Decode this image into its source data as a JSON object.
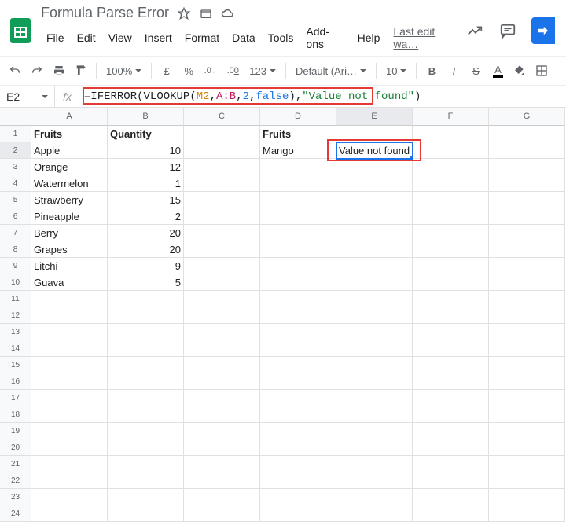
{
  "header": {
    "doc_title": "Formula Parse Error",
    "menus": [
      "File",
      "Edit",
      "View",
      "Insert",
      "Format",
      "Data",
      "Tools",
      "Add-ons",
      "Help"
    ],
    "last_edit": "Last edit wa…"
  },
  "toolbar": {
    "zoom": "100%",
    "currency": "£",
    "percent": "%",
    "dec_dec": ".0",
    "dec_inc": ".00",
    "num_format": "123",
    "font": "Default (Ari…",
    "font_size": "10",
    "bold": "B",
    "italic": "I",
    "strike": "S"
  },
  "namebox": {
    "ref": "E2",
    "fx": "fx"
  },
  "formula": {
    "eq": "=",
    "fn1": "IFERROR",
    "lp1": "(",
    "fn2": "VLOOKUP",
    "lp2": "(",
    "ref1": "M2",
    "c1": ",",
    "ref2": "A:B",
    "c2": ",",
    "arg_n": "2",
    "c3": ",",
    "arg_b": "false",
    "rp2": ")",
    "c4": ", ",
    "str": "\"Value not found\"",
    "rp1": ")"
  },
  "columns": [
    "A",
    "B",
    "C",
    "D",
    "E",
    "F",
    "G"
  ],
  "rows": [
    "1",
    "2",
    "3",
    "4",
    "5",
    "6",
    "7",
    "8",
    "9",
    "10",
    "11",
    "12",
    "13",
    "14",
    "15",
    "16",
    "17",
    "18",
    "19",
    "20",
    "21",
    "22",
    "23",
    "24"
  ],
  "cells": {
    "r1": {
      "A": "Fruits",
      "B": "Quantity",
      "D": "Fruits"
    },
    "r2": {
      "A": "Apple",
      "B": "10",
      "D": "Mango",
      "E": "Value not found"
    },
    "r3": {
      "A": "Orange",
      "B": "12"
    },
    "r4": {
      "A": "Watermelon",
      "B": "1"
    },
    "r5": {
      "A": "Strawberry",
      "B": "15"
    },
    "r6": {
      "A": "Pineapple",
      "B": "2"
    },
    "r7": {
      "A": "Berry",
      "B": "20"
    },
    "r8": {
      "A": "Grapes",
      "B": "20"
    },
    "r9": {
      "A": "Litchi",
      "B": "9"
    },
    "r10": {
      "A": "Guava",
      "B": "5"
    }
  }
}
